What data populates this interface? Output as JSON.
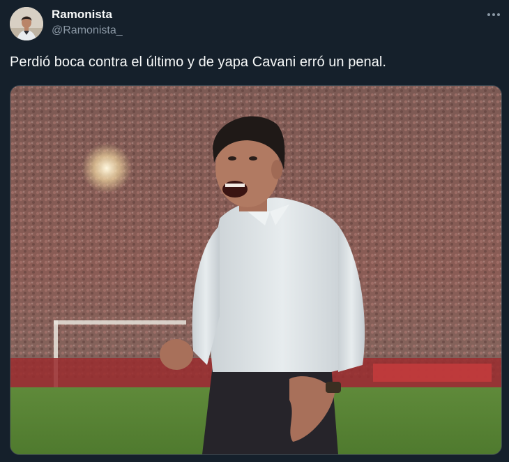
{
  "tweet": {
    "author": {
      "display_name": "Ramonista",
      "handle": "@Ramonista_",
      "avatar_icon": "profile-photo-avatar"
    },
    "text": "Perdió boca contra el último y de yapa Cavani erró un penal.",
    "more_icon": "more-horizontal-icon",
    "media": {
      "kind": "photo",
      "alt": ""
    }
  },
  "colors": {
    "background": "#15202b",
    "primary_text": "#f7f9f9",
    "secondary_text": "#8b98a5",
    "border": "#38444d"
  }
}
